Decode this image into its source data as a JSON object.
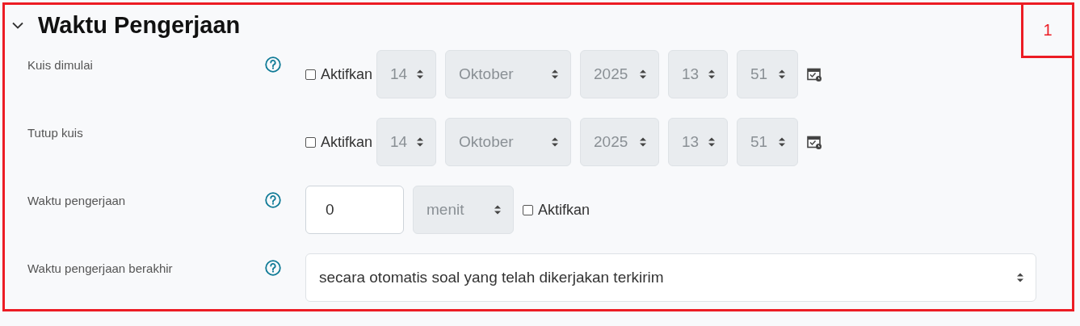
{
  "section": {
    "title": "Waktu Pengerjaan",
    "expanded": true
  },
  "annotation": {
    "number": "1"
  },
  "fields": [
    {
      "kind": "datetime",
      "label": "Kuis dimulai",
      "help": true,
      "enable": {
        "label": "Aktifkan",
        "checked": false
      },
      "selects": [
        "14",
        "Oktober",
        "2025",
        "13",
        "51"
      ]
    },
    {
      "kind": "datetime",
      "label": "Tutup kuis",
      "help": false,
      "enable": {
        "label": "Aktifkan",
        "checked": false
      },
      "selects": [
        "14",
        "Oktober",
        "2025",
        "13",
        "51"
      ]
    },
    {
      "kind": "duration",
      "label": "Waktu pengerjaan",
      "help": true,
      "value": "0",
      "unit": "menit",
      "enable": {
        "label": "Aktifkan",
        "checked": false
      }
    },
    {
      "kind": "select",
      "label": "Waktu pengerjaan berakhir",
      "help": true,
      "value": "secara otomatis soal yang telah dikerjakan terkirim"
    }
  ]
}
